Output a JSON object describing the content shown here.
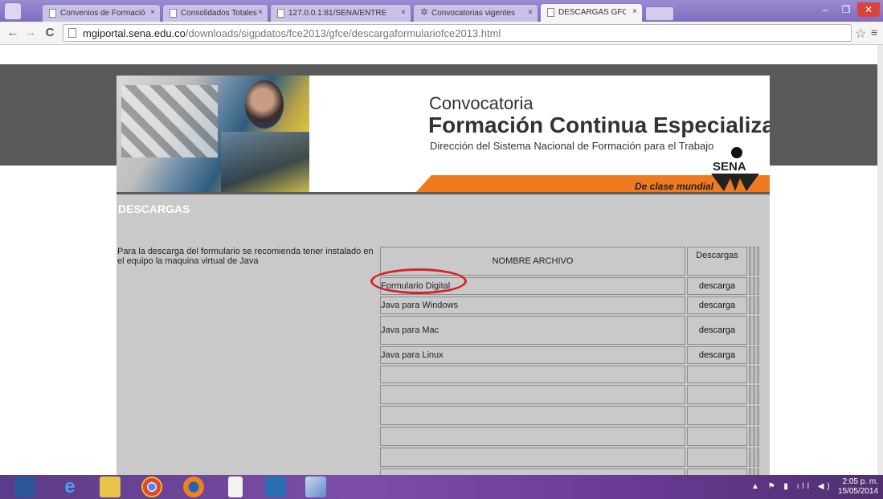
{
  "browser": {
    "tabs": [
      {
        "label": "Convenios de Formación",
        "close": "×",
        "active": false
      },
      {
        "label": "Consolidados Totales",
        "close": "×",
        "active": false
      },
      {
        "label": "127.0.0.1:81/SENA/ENTRE",
        "close": "×",
        "active": false
      },
      {
        "label": "Convocatorias vigentes",
        "close": "×",
        "active": false
      },
      {
        "label": "DESCARGAS GFCE",
        "close": "×",
        "active": true
      }
    ],
    "url_domain": "mgiportal.sena.edu.co",
    "url_path": "/downloads/sigpdatos/fce2013/gfce/descargaformulariofce2013.html"
  },
  "banner": {
    "line1": "Convocatoria",
    "line2": "Formación Continua Especializada",
    "line3": "Dirección del Sistema Nacional de Formación para el Trabajo",
    "tagline": "De clase mundial",
    "logo_text": "SENA"
  },
  "page": {
    "section_title": "DESCARGAS",
    "intro": "Para la descarga del formulario se recomienda tener instalado en el equipo la maquina virtual de Java",
    "table_headers": {
      "name": "NOMBRE ARCHIVO",
      "downloads": "Descargas"
    },
    "files": [
      {
        "name": "Formulario Digital",
        "action": "descarga"
      },
      {
        "name": "Java para Windows",
        "action": "descarga"
      },
      {
        "name": "Java para Mac",
        "action": "descarga"
      },
      {
        "name": "Java para Linux",
        "action": "descarga"
      }
    ]
  },
  "taskbar": {
    "time": "2:05 p. m.",
    "date": "15/05/2014"
  },
  "colors": {
    "orange_band": "#f07a1e",
    "highlight_circle": "#d2232a",
    "page_grey": "#c9c9c9",
    "dark_band": "#595959"
  }
}
